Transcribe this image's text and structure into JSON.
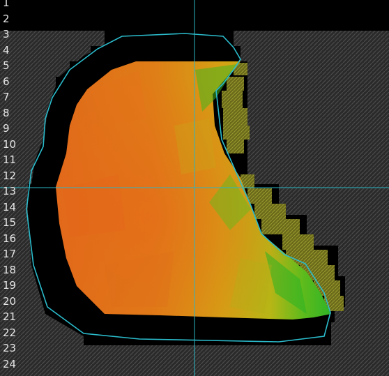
{
  "rows": [
    "1",
    "2",
    "3",
    "4",
    "5",
    "6",
    "7",
    "8",
    "9",
    "10",
    "11",
    "12",
    "13",
    "14",
    "15",
    "16",
    "17",
    "18",
    "19",
    "20",
    "21",
    "22",
    "23",
    "24"
  ],
  "colors": {
    "background": "#000000",
    "hatch_light": "#4a4a4a",
    "hatch_dark": "#202020",
    "crosshair": "#2bb5c4",
    "outline": "#2bbccc",
    "heat_low": "#e0661a",
    "heat_mid": "#d6a414",
    "heat_high": "#3fb81f",
    "stepped_hatch": "#8a8a2a"
  },
  "crosshair": {
    "column": "center",
    "row": "13"
  }
}
